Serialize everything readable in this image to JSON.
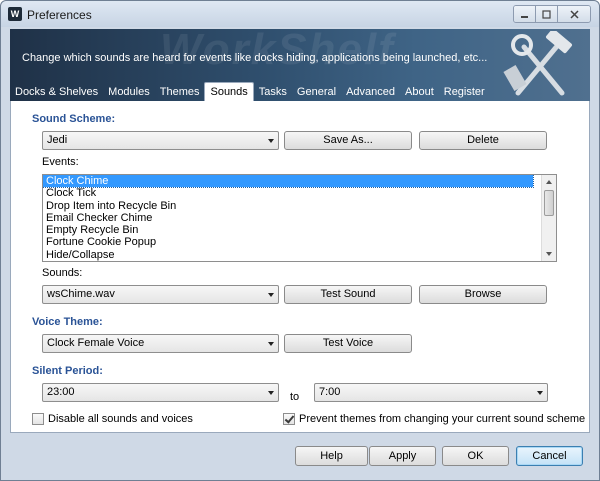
{
  "window": {
    "title": "Preferences",
    "app_icon": "workshelf-icon",
    "controls": [
      "minimize-icon",
      "maximize-icon",
      "close-icon"
    ]
  },
  "banner": {
    "description": "Change which sounds are heard for events like docks hiding, applications being launched, etc...",
    "watermark": "WorkShelf",
    "graphic": "hammer-wrench-tools-icon"
  },
  "tabs": [
    {
      "label": "Docks & Shelves"
    },
    {
      "label": "Modules"
    },
    {
      "label": "Themes"
    },
    {
      "label": "Sounds",
      "active": true
    },
    {
      "label": "Tasks"
    },
    {
      "label": "General"
    },
    {
      "label": "Advanced"
    },
    {
      "label": "About"
    },
    {
      "label": "Register"
    }
  ],
  "sound_scheme": {
    "heading": "Sound Scheme:",
    "selected": "Jedi",
    "save_as_label": "Save As...",
    "delete_label": "Delete"
  },
  "events": {
    "label": "Events:",
    "items": [
      "Clock Chime",
      "Clock Tick",
      "Drop Item into Recycle Bin",
      "Email Checker Chime",
      "Empty Recycle Bin",
      "Fortune Cookie Popup",
      "Hide/Collapse"
    ],
    "selected_index": 0
  },
  "sounds": {
    "label": "Sounds:",
    "selected": "wsChime.wav",
    "test_label": "Test Sound",
    "browse_label": "Browse"
  },
  "voice_theme": {
    "heading": "Voice Theme:",
    "selected": "Clock Female Voice",
    "test_label": "Test Voice"
  },
  "silent_period": {
    "heading": "Silent Period:",
    "from": "23:00",
    "to_label": "to",
    "to": "7:00"
  },
  "options": {
    "disable_all": {
      "label": "Disable all sounds and voices",
      "checked": false
    },
    "prevent_themes": {
      "label": "Prevent themes from changing your current sound scheme",
      "checked": true
    }
  },
  "footer": {
    "help_label": "Help",
    "apply_label": "Apply",
    "ok_label": "OK",
    "cancel_label": "Cancel"
  },
  "colors": {
    "section_heading": "#2a5396",
    "selection": "#3399ff",
    "banner_dark": "#1f3147",
    "window_frame": "#cfd9e6"
  }
}
